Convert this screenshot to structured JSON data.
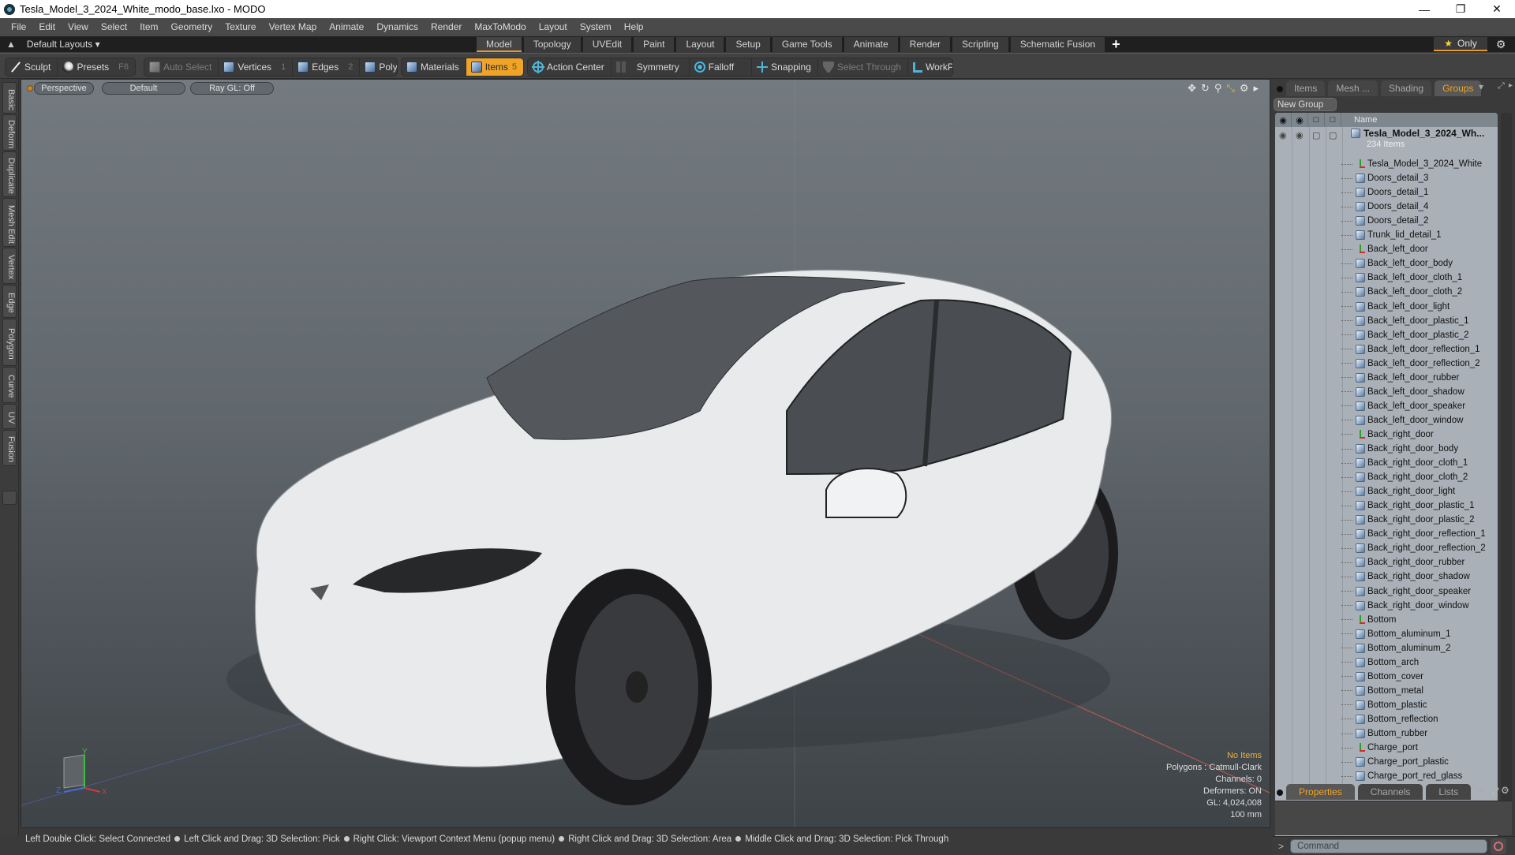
{
  "window": {
    "title": "Tesla_Model_3_2024_White_modo_base.lxo - MODO",
    "controls": [
      "minimize",
      "restore",
      "close"
    ]
  },
  "menubar": [
    "File",
    "Edit",
    "View",
    "Select",
    "Item",
    "Geometry",
    "Texture",
    "Vertex Map",
    "Animate",
    "Dynamics",
    "Render",
    "MaxToModo",
    "Layout",
    "System",
    "Help"
  ],
  "layoutbar": {
    "layouts_label": "Default Layouts ▾",
    "tabs": [
      {
        "label": "Model",
        "active": true
      },
      {
        "label": "Topology"
      },
      {
        "label": "UVEdit"
      },
      {
        "label": "Paint"
      },
      {
        "label": "Layout"
      },
      {
        "label": "Setup"
      },
      {
        "label": "Game Tools"
      },
      {
        "label": "Animate"
      },
      {
        "label": "Render"
      },
      {
        "label": "Scripting"
      },
      {
        "label": "Schematic Fusion"
      }
    ],
    "add_tab": "+",
    "only_label": "Only"
  },
  "toolbar": {
    "sculpt": "Sculpt",
    "presets": "Presets",
    "presets_key": "F6",
    "auto_select": "Auto Select",
    "vertices": "Vertices",
    "vertices_key": "1",
    "edges": "Edges",
    "edges_key": "2",
    "polygons": "Polygons",
    "materials": "Materials",
    "items": "Items",
    "items_key": "5",
    "action_center": "Action Center",
    "symmetry": "Symmetry",
    "falloff": "Falloff",
    "snapping": "Snapping",
    "select_through": "Select Through",
    "workplane": "WorkPlane"
  },
  "left_tabs": [
    "Basic",
    "Deform",
    "Duplicate",
    "Mesh Edit",
    "Vertex",
    "Edge",
    "Polygon",
    "Curve",
    "UV",
    "Fusion"
  ],
  "viewport": {
    "view": "Perspective",
    "shading": "Default",
    "raygl": "Ray GL: Off",
    "info": {
      "selection": "No Items",
      "polygons": "Polygons : Catmull-Clark",
      "channels": "Channels: 0",
      "deformers": "Deformers: ON",
      "gl": "GL: 4,024,008",
      "grid": "100 mm"
    },
    "axes": {
      "x": "X",
      "y": "Y",
      "z": "Z"
    }
  },
  "statusbar": [
    "Left Double Click: Select Connected",
    "Left Click and Drag: 3D Selection: Pick",
    "Right Click: Viewport Context Menu (popup menu)",
    "Right Click and Drag: 3D Selection: Area",
    "Middle Click and Drag: 3D Selection: Pick Through"
  ],
  "rightpanel": {
    "tabs": [
      {
        "label": "Items"
      },
      {
        "label": "Mesh ..."
      },
      {
        "label": "Shading"
      },
      {
        "label": "Groups",
        "active": true
      }
    ],
    "new_group": "New Group",
    "name_header": "Name",
    "root": {
      "name": "Tesla_Model_3_2024_Wh...",
      "count": "234 Items"
    },
    "items": [
      {
        "name": "Tesla_Model_3_2024_White",
        "type": "locator"
      },
      {
        "name": "Doors_detail_3",
        "type": "mesh"
      },
      {
        "name": "Doors_detail_1",
        "type": "mesh"
      },
      {
        "name": "Doors_detail_4",
        "type": "mesh"
      },
      {
        "name": "Doors_detail_2",
        "type": "mesh"
      },
      {
        "name": "Trunk_lid_detail_1",
        "type": "mesh"
      },
      {
        "name": "Back_left_door",
        "type": "locator"
      },
      {
        "name": "Back_left_door_body",
        "type": "mesh"
      },
      {
        "name": "Back_left_door_cloth_1",
        "type": "mesh"
      },
      {
        "name": "Back_left_door_cloth_2",
        "type": "mesh"
      },
      {
        "name": "Back_left_door_light",
        "type": "mesh"
      },
      {
        "name": "Back_left_door_plastic_1",
        "type": "mesh"
      },
      {
        "name": "Back_left_door_plastic_2",
        "type": "mesh"
      },
      {
        "name": "Back_left_door_reflection_1",
        "type": "mesh"
      },
      {
        "name": "Back_left_door_reflection_2",
        "type": "mesh"
      },
      {
        "name": "Back_left_door_rubber",
        "type": "mesh"
      },
      {
        "name": "Back_left_door_shadow",
        "type": "mesh"
      },
      {
        "name": "Back_left_door_speaker",
        "type": "mesh"
      },
      {
        "name": "Back_left_door_window",
        "type": "mesh"
      },
      {
        "name": "Back_right_door",
        "type": "locator"
      },
      {
        "name": "Back_right_door_body",
        "type": "mesh"
      },
      {
        "name": "Back_right_door_cloth_1",
        "type": "mesh"
      },
      {
        "name": "Back_right_door_cloth_2",
        "type": "mesh"
      },
      {
        "name": "Back_right_door_light",
        "type": "mesh"
      },
      {
        "name": "Back_right_door_plastic_1",
        "type": "mesh"
      },
      {
        "name": "Back_right_door_plastic_2",
        "type": "mesh"
      },
      {
        "name": "Back_right_door_reflection_1",
        "type": "mesh"
      },
      {
        "name": "Back_right_door_reflection_2",
        "type": "mesh"
      },
      {
        "name": "Back_right_door_rubber",
        "type": "mesh"
      },
      {
        "name": "Back_right_door_shadow",
        "type": "mesh"
      },
      {
        "name": "Back_right_door_speaker",
        "type": "mesh"
      },
      {
        "name": "Back_right_door_window",
        "type": "mesh"
      },
      {
        "name": "Bottom",
        "type": "locator"
      },
      {
        "name": "Bottom_aluminum_1",
        "type": "mesh"
      },
      {
        "name": "Bottom_aluminum_2",
        "type": "mesh"
      },
      {
        "name": "Bottom_arch",
        "type": "mesh"
      },
      {
        "name": "Bottom_cover",
        "type": "mesh"
      },
      {
        "name": "Bottom_metal",
        "type": "mesh"
      },
      {
        "name": "Bottom_plastic",
        "type": "mesh"
      },
      {
        "name": "Bottom_reflection",
        "type": "mesh"
      },
      {
        "name": "Buttom_rubber",
        "type": "mesh"
      },
      {
        "name": "Charge_port",
        "type": "locator"
      },
      {
        "name": "Charge_port_plastic",
        "type": "mesh"
      },
      {
        "name": "Charge_port_red_glass",
        "type": "mesh"
      }
    ],
    "bottom_tabs": [
      {
        "label": "Properties",
        "active": true
      },
      {
        "label": "Channels"
      },
      {
        "label": "Lists"
      }
    ],
    "bottom_add": "+",
    "command_placeholder": "Command",
    "command_prompt": ">"
  },
  "colors": {
    "accent": "#f0a327",
    "panel_bg": "#3a3a3a",
    "list_bg": "#a9b0b7",
    "info_highlight": "#e6b33b"
  }
}
